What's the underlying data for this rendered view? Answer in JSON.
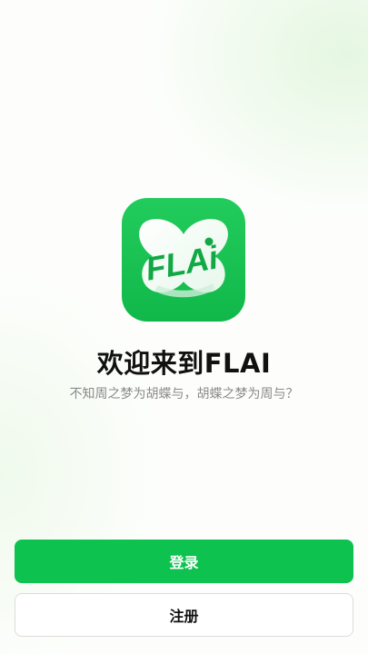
{
  "app": {
    "icon_name": "flai-logo-icon",
    "logo_text": "FLAi",
    "brand_color": "#0EC250"
  },
  "welcome": {
    "title": "欢迎来到FLAI",
    "subtitle": "不知周之梦为胡蝶与，胡蝶之梦为周与？"
  },
  "actions": {
    "login_label": "登录",
    "register_label": "注册"
  }
}
